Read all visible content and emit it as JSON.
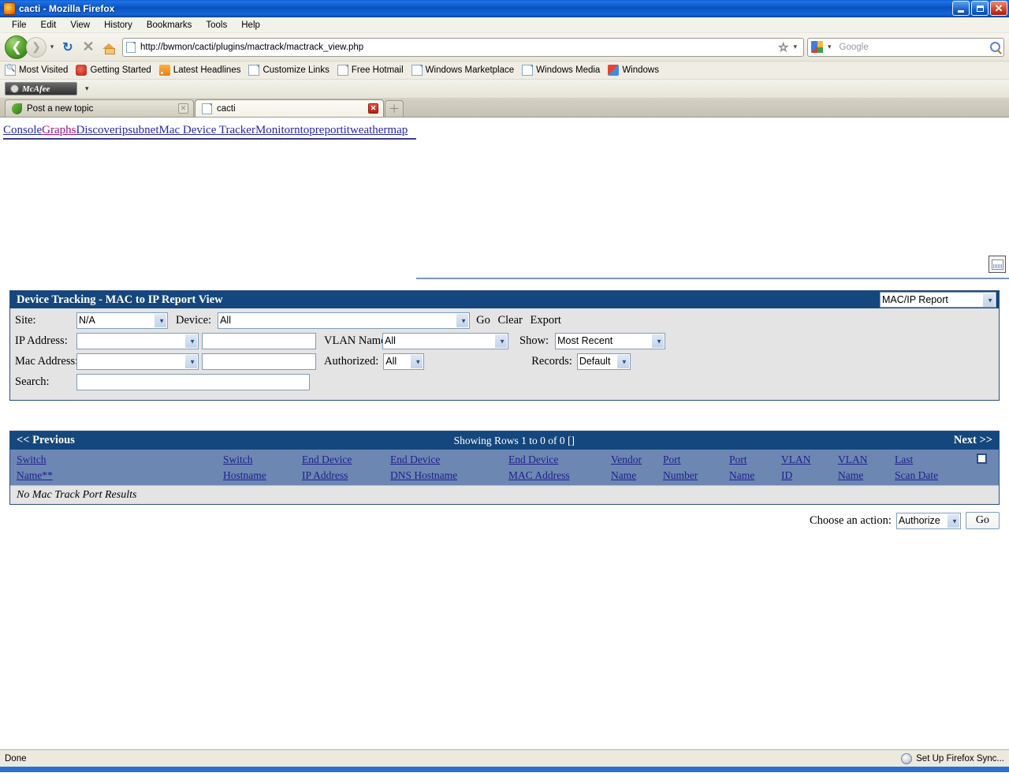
{
  "window": {
    "title": "cacti - Mozilla Firefox",
    "app_icon": "firefox-icon",
    "minimize_label": "Minimize",
    "maximize_label": "Maximize",
    "close_label": "Close"
  },
  "menubar": {
    "items": [
      "File",
      "Edit",
      "View",
      "History",
      "Bookmarks",
      "Tools",
      "Help"
    ]
  },
  "toolbar": {
    "back_glyph": "❮",
    "forward_glyph": "❯",
    "dropdown_glyph": "▾",
    "reload_glyph": "↻",
    "stop_glyph": "✕",
    "home_label": "Home",
    "url": "http://bwmon/cacti/plugins/mactrack/mactrack_view.php",
    "star_glyph": "☆",
    "url_caret": "▾",
    "search_placeholder": "Google",
    "search_engine": "Google",
    "search_caret": "▾"
  },
  "bookmarks": [
    {
      "label": "Most Visited",
      "icon": "most-visited-icon"
    },
    {
      "label": "Getting Started",
      "icon": "getting-started-icon"
    },
    {
      "label": "Latest Headlines",
      "icon": "rss-icon"
    },
    {
      "label": "Customize Links",
      "icon": "doc-icon"
    },
    {
      "label": "Free Hotmail",
      "icon": "doc-icon"
    },
    {
      "label": "Windows Marketplace",
      "icon": "doc-icon"
    },
    {
      "label": "Windows Media",
      "icon": "doc-icon"
    },
    {
      "label": "Windows",
      "icon": "windows-icon"
    }
  ],
  "mcafee": {
    "label": "McAfee",
    "caret": "▾"
  },
  "tabs": [
    {
      "label": "Post a new topic",
      "icon": "leaf-icon",
      "close_glyph": "✕",
      "active": false
    },
    {
      "label": "cacti",
      "icon": "doc-icon",
      "close_glyph": "✕",
      "active": true
    }
  ],
  "new_tab_glyph": "＋",
  "cacti_nav": [
    {
      "label": "Console",
      "color": "#2727b0"
    },
    {
      "label": "Graphs",
      "color": "#a0148a"
    },
    {
      "label": "Discover",
      "color": "#2727b0"
    },
    {
      "label": "ipsubnet",
      "color": "#2727b0"
    },
    {
      "label": "Mac Device Tracker",
      "color": "#2727b0"
    },
    {
      "label": "Monitor",
      "color": "#2727b0"
    },
    {
      "label": "ntopreport",
      "color": "#2727b0"
    },
    {
      "label": "itweathermap",
      "color": "#2727b0"
    }
  ],
  "panel": {
    "title": "Device Tracking - MAC to IP Report View",
    "report_select": {
      "value": "MAC/IP Report",
      "options": [
        "MAC/IP Report"
      ]
    },
    "fields": {
      "site_label": "Site:",
      "site_value": "N/A",
      "device_label": "Device:",
      "device_value": "All",
      "go_label": "Go",
      "clear_label": "Clear",
      "export_label": "Export",
      "ip_label": "IP Address:",
      "ip_op_value": "",
      "ip_text_value": "",
      "vlan_label": "VLAN Name:",
      "vlan_value": "All",
      "show_label": "Show:",
      "show_value": "Most Recent",
      "mac_label": "Mac Address:",
      "mac_op_value": "",
      "mac_text_value": "",
      "authorized_label": "Authorized:",
      "authorized_value": "All",
      "records_label": "Records:",
      "records_value": "Default",
      "search_label": "Search:",
      "search_value": ""
    }
  },
  "results": {
    "previous_label": "<< Previous",
    "showing_label": "Showing Rows 1 to 0 of 0 []",
    "next_label": "Next >>",
    "columns": [
      "Switch Name**",
      "Switch Hostname",
      "End Device IP Address",
      "End Device DNS Hostname",
      "End Device MAC Address",
      "Vendor Name",
      "Port Number",
      "Port Name",
      "VLAN ID",
      "VLAN Name",
      "Last Scan Date"
    ],
    "columns_split": [
      {
        "l1": "Switch",
        "l2": "Name**"
      },
      {
        "l1": "Switch",
        "l2": "Hostname"
      },
      {
        "l1": "End Device",
        "l2": "IP Address"
      },
      {
        "l1": "End Device",
        "l2": "DNS Hostname"
      },
      {
        "l1": "End Device",
        "l2": "MAC Address"
      },
      {
        "l1": "Vendor",
        "l2": "Name"
      },
      {
        "l1": "Port",
        "l2": "Number"
      },
      {
        "l1": "Port",
        "l2": "Name"
      },
      {
        "l1": "VLAN",
        "l2": "ID"
      },
      {
        "l1": "VLAN",
        "l2": "Name"
      },
      {
        "l1": "Last",
        "l2": "Scan Date"
      }
    ],
    "rows": [],
    "empty_message": "No Mac Track Port Results"
  },
  "action": {
    "label": "Choose an action:",
    "value": "Authorize",
    "go_label": "Go"
  },
  "statusbar": {
    "status": "Done",
    "sync_label": "Set Up Firefox Sync..."
  },
  "colors": {
    "titlebar": "#0b52c0",
    "panel_header": "#14477d",
    "table_header": "#6d87b3",
    "panel_body": "#e4e4e4",
    "link": "#2727b0",
    "link_alt": "#a0148a"
  }
}
